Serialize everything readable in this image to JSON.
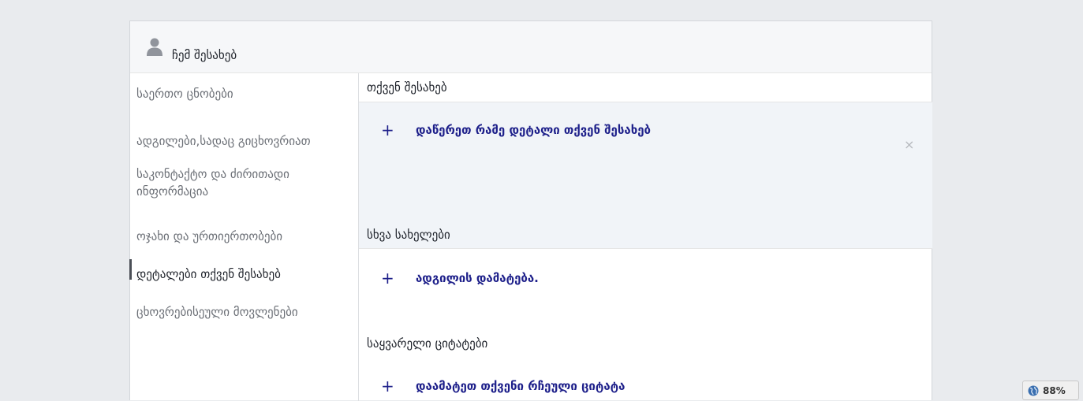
{
  "header": {
    "title": "ჩემ შესახებ",
    "icon": "user-silhouette-icon"
  },
  "sidebar": {
    "items": [
      {
        "label": "საერთო ცნობები"
      },
      {
        "label": "ადგილები,სადაც გიცხოვრიათ"
      },
      {
        "label": "საკონტაქტო და ძირითადი ინფორმაცია"
      },
      {
        "label": "ოჯახი და ურთიერთობები"
      },
      {
        "label": "დეტალები თქვენ შესახებ"
      },
      {
        "label": "ცხოვრებისეული მოვლენები"
      }
    ],
    "active_index": 4
  },
  "sections": {
    "about": {
      "heading": "თქვენ შესახებ",
      "action": "დაწერეთ რამე დეტალი თქვენ შესახებ",
      "close": "×"
    },
    "other_names": {
      "heading": "სხვა სახელები",
      "action": "ადგილის დამატება."
    },
    "quotes": {
      "heading": "საყვარელი ციტატები",
      "action": "დაამატეთ თქვენი რჩეული ციტატა"
    },
    "plus": "+"
  },
  "zoom": {
    "value": "88%",
    "icon": "globe-icon"
  },
  "colors": {
    "link": "#1d1f8a",
    "background": "#e9ebee",
    "highlight": "#f1f4f8"
  }
}
